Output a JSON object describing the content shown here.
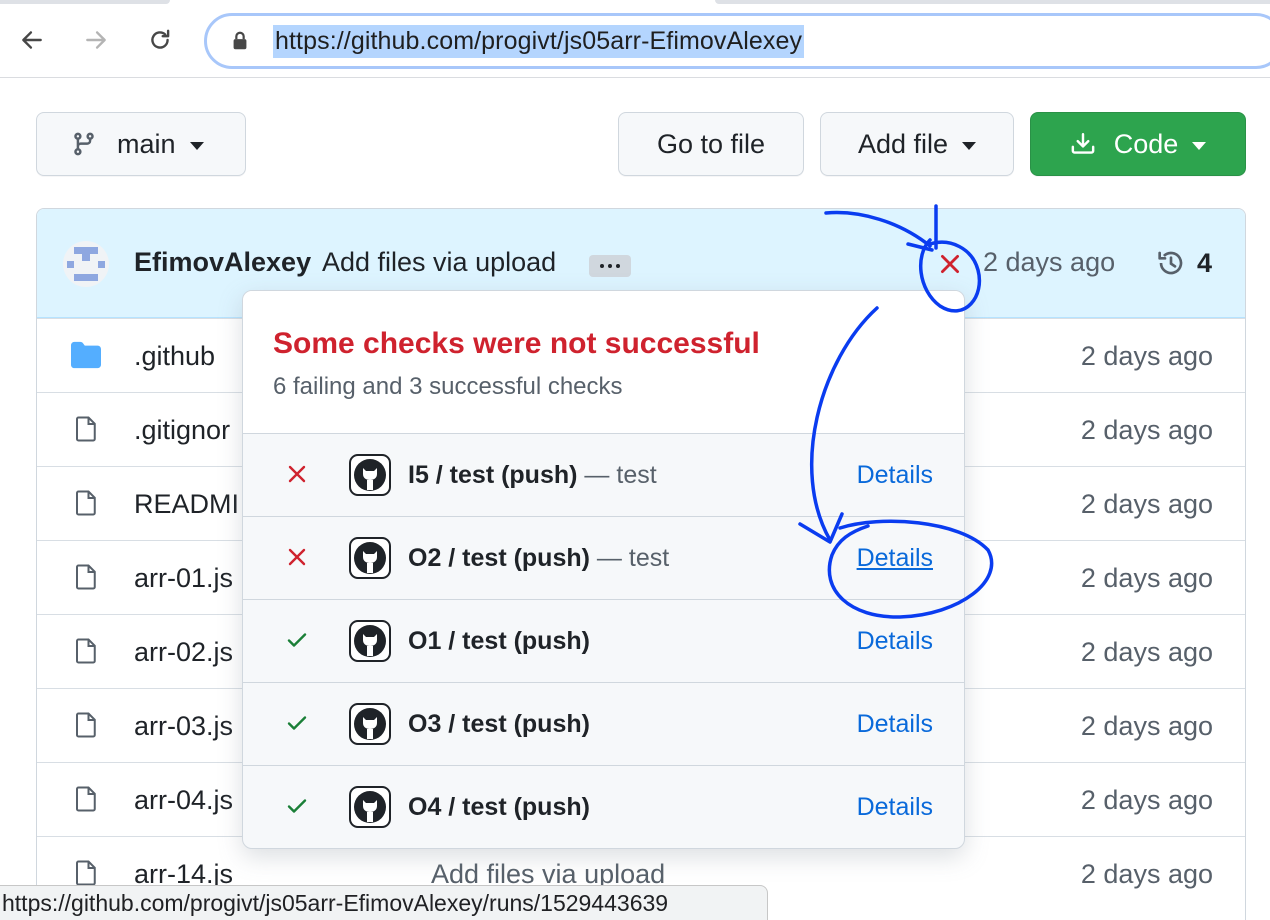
{
  "browser": {
    "url": "https://github.com/progivt/js05arr-EfimovAlexey",
    "status_url": "https://github.com/progivt/js05arr-EfimovAlexey/runs/1529443639"
  },
  "toolbar": {
    "branch_label": "main",
    "go_to_file_label": "Go to file",
    "add_file_label": "Add file",
    "code_label": "Code",
    "code_button_color": "#2da44e"
  },
  "commit": {
    "author": "EfimovAlexey",
    "message": "Add files via upload",
    "status": "failure",
    "time": "2 days ago",
    "history_count": "4"
  },
  "files": [
    {
      "name": ".github",
      "type": "folder",
      "message": "",
      "time": "2 days ago"
    },
    {
      "name": ".gitignor",
      "type": "file",
      "message": "",
      "time": "2 days ago"
    },
    {
      "name": "READMI",
      "type": "file",
      "message": "",
      "time": "2 days ago"
    },
    {
      "name": "arr-01.js",
      "type": "file",
      "message": "",
      "time": "2 days ago"
    },
    {
      "name": "arr-02.js",
      "type": "file",
      "message": "",
      "time": "2 days ago"
    },
    {
      "name": "arr-03.js",
      "type": "file",
      "message": "",
      "time": "2 days ago"
    },
    {
      "name": "arr-04.js",
      "type": "file",
      "message": "",
      "time": "2 days ago"
    },
    {
      "name": "arr-14.js",
      "type": "file",
      "message": "Add files via upload",
      "time": "2 days ago"
    }
  ],
  "checks_popover": {
    "title": "Some checks were not successful",
    "subtitle": "6 failing and 3 successful checks",
    "checks": [
      {
        "status": "failure",
        "name": "I5 / test (push)",
        "description": "— test",
        "details_label": "Details"
      },
      {
        "status": "failure",
        "name": "O2 / test (push)",
        "description": "— test",
        "details_label": "Details"
      },
      {
        "status": "success",
        "name": "O1 / test (push)",
        "description": "",
        "details_label": "Details"
      },
      {
        "status": "success",
        "name": "O3 / test (push)",
        "description": "",
        "details_label": "Details"
      },
      {
        "status": "success",
        "name": "O4 / test (push)",
        "description": "",
        "details_label": "Details"
      }
    ]
  },
  "colors": {
    "failure": "#cf222e",
    "success": "#1a7f37",
    "link": "#0969da",
    "annotation": "#0a3cf0"
  },
  "icons": {
    "back": "arrow-left-icon",
    "forward": "arrow-right-icon",
    "reload": "reload-icon",
    "lock": "lock-icon",
    "branch": "git-branch-icon",
    "download": "download-icon",
    "history": "history-icon",
    "folder": "folder-icon",
    "file": "file-icon",
    "github": "github-mark-icon",
    "x": "x-icon",
    "check": "check-icon"
  }
}
